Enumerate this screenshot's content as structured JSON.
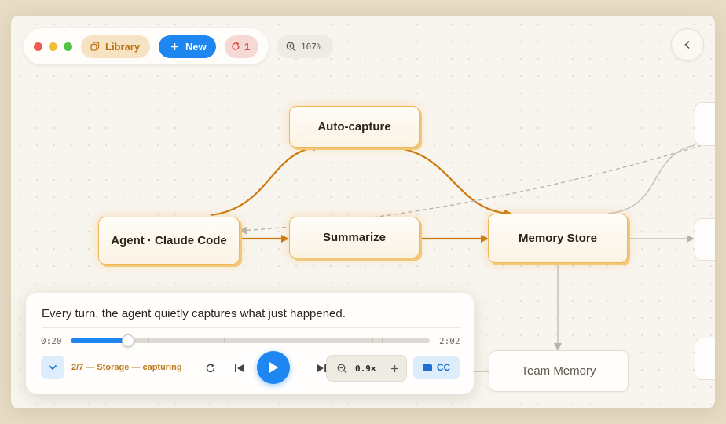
{
  "toolbar": {
    "library_label": "Library",
    "new_label": "New",
    "sync_count": "1",
    "zoom_level": "107%"
  },
  "graph": {
    "nodes": {
      "auto_capture": "Auto-capture",
      "agent": "Agent · Claude Code",
      "summarize": "Summarize",
      "memory_store": "Memory Store",
      "team_memory": "Team Memory"
    }
  },
  "player": {
    "caption": "Every turn, the agent quietly captures what just happened.",
    "current_time": "0:20",
    "total_time": "2:02",
    "progress": 0.16,
    "chapter": "2/7 — Storage — capturing",
    "speed": "0.9×",
    "cc_label": "CC"
  },
  "colors": {
    "accent": "#1d86f0",
    "highlight": "#f0b75a",
    "edge_active": "#cc7a10"
  }
}
